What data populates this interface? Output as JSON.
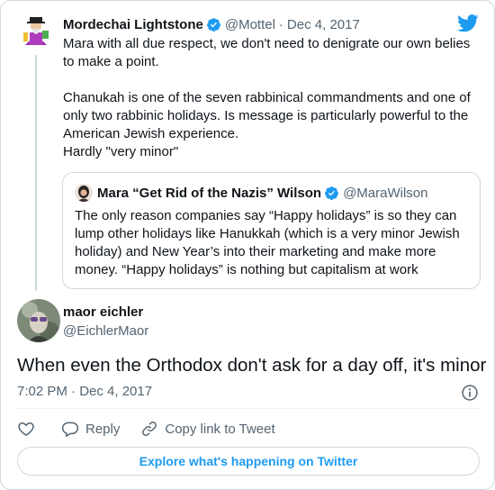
{
  "parent_tweet": {
    "display_name": "Mordechai Lightstone",
    "handle": "@Mottel",
    "separator": "·",
    "date": "Dec 4, 2017",
    "paragraphs": [
      "Mara with all due respect, we don't need to denigrate our own belies to make a point.",
      "Chanukah is one of the seven rabbinical commandments and one of only two rabbinic holidays. Is message is particularly powerful to the American Jewish experience.",
      "Hardly \"very minor\""
    ]
  },
  "quoted_tweet": {
    "display_name": "Mara “Get Rid of the Nazis” Wilson",
    "handle": "@MaraWilson",
    "text": "The only reason companies say “Happy holidays” is so they can lump other holidays like Hanukkah (which is a very minor Jewish holiday) and New Year’s into their marketing and make more money. “Happy holidays” is nothing but capitalism at work"
  },
  "main_tweet": {
    "display_name": "maor eichler",
    "handle": "@EichlerMaor",
    "text": "When even the Orthodox don't ask for a day off, it's minor",
    "timestamp": "7:02 PM · Dec 4, 2017"
  },
  "actions": {
    "reply_label": "Reply",
    "copy_link_label": "Copy link to Tweet"
  },
  "explore_label": "Explore what's happening on Twitter",
  "colors": {
    "twitter_blue": "#1d9bf0",
    "text_primary": "#0f1419",
    "text_secondary": "#536471",
    "border": "#cfd9de",
    "like_red": "#536471"
  },
  "icons": [
    "twitter-bird-icon",
    "verified-badge-icon",
    "info-icon",
    "heart-icon",
    "reply-icon",
    "link-icon"
  ]
}
